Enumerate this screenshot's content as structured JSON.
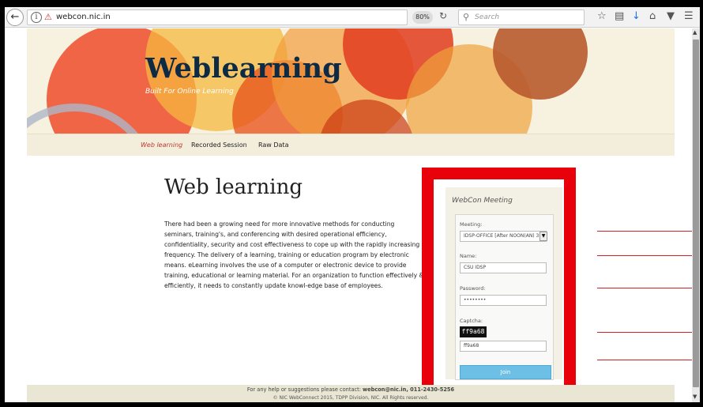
{
  "browser": {
    "url": "webcon.nic.in",
    "zoom": "80%",
    "search_placeholder": "Search"
  },
  "site": {
    "logo": "Weblearning",
    "tagline": "Built For Online Learning",
    "nav": [
      "Web learning",
      "Recorded Session",
      "Raw Data"
    ],
    "active_nav": "Web learning"
  },
  "main": {
    "title": "Web learning",
    "paragraph": "There had been a growing need for more innovative methods for conducting seminars, training's, and conferencing with desired operational efficiency, confidentiality, security and cost effectiveness to cope up with the rapidly increasing frequency. The delivery of a learning, training or education program by electronic means. eLearning involves the use of a computer or electronic device to provide training, educational or learning material. For an organization to function effectively & efficiently, it needs to constantly update knowl-edge base of employees."
  },
  "meeting": {
    "heading": "WebCon Meeting",
    "meeting_label": "Meeting:",
    "meeting_value": "IDSP-OFFICE [After NOON(AN) 3(",
    "name_label": "Name:",
    "name_value": "CSU IDSP",
    "password_label": "Password:",
    "password_value": "••••••••",
    "captcha_label": "Captcha:",
    "captcha_text": "ff9a68",
    "captcha_value": "ff9a68",
    "join_label": "Join"
  },
  "footer": {
    "line1_prefix": "For any help or suggestions please contact: ",
    "line1_contact": "webcon@nic.in, 011-2430-5256",
    "line2": "© NIC WebConnect 2015, TDPP Division, NIC. All Rights reserved."
  },
  "colors": {
    "highlight_box": "#e8000b",
    "annotation_line": "#d42020",
    "logo": "#0d2b44",
    "join_button": "#6dbfe6",
    "active_nav": "#c0392b"
  }
}
